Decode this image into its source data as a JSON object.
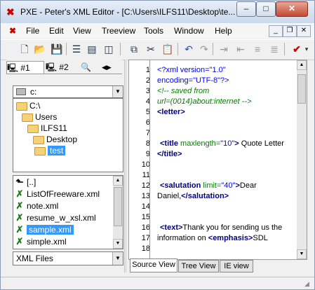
{
  "window": {
    "title": "PXE - Peter's XML Editor - [C:\\Users\\ILFS11\\Desktop\\te...",
    "minimize": "–",
    "maximize": "□",
    "close": "✕"
  },
  "menu": {
    "items": [
      "File",
      "Edit",
      "View",
      "Treeview",
      "Tools",
      "Window",
      "Help"
    ],
    "mdi_minimize": "_",
    "mdi_restore": "❐",
    "mdi_close": "✕"
  },
  "toolbar": {
    "icons": [
      "new-file-icon",
      "open-folder-icon",
      "save-icon",
      "tile-horizontal-icon",
      "tile-vertical-icon",
      "tile-icon",
      "copy-icon",
      "cut-icon",
      "paste-icon",
      "undo-icon",
      "redo-icon",
      "indent-icon",
      "outdent-icon",
      "format-icon",
      "validate-icon"
    ]
  },
  "left_tabs": {
    "tab1": "#1",
    "tab2": "#2"
  },
  "drive": {
    "value": "c:"
  },
  "directories": [
    {
      "label": "C:\\",
      "indent": 0
    },
    {
      "label": "Users",
      "indent": 1
    },
    {
      "label": "ILFS11",
      "indent": 2
    },
    {
      "label": "Desktop",
      "indent": 3
    },
    {
      "label": "test",
      "indent": 4,
      "selected": true
    }
  ],
  "parent_dir": "[..]",
  "files": [
    {
      "label": "ListOfFreeware.xml"
    },
    {
      "label": "note.xml"
    },
    {
      "label": "resume_w_xsl.xml"
    },
    {
      "label": "sample.xml",
      "selected": true
    },
    {
      "label": "simple.xml"
    }
  ],
  "file_filter": {
    "value": "XML Files"
  },
  "editor": {
    "line_numbers": [
      "1",
      "2",
      "3",
      "4",
      "5",
      "6",
      "7",
      "8",
      "9",
      "10",
      "11",
      "12",
      "13",
      "14",
      "15",
      "16",
      "17",
      "18"
    ],
    "lines": {
      "l1": "<?xml version=\"1.0\"",
      "l2": "encoding=\"UTF-8\"?>",
      "l3": "<!-- saved from",
      "l4": "url=(0014)about:internet -->",
      "l5": "<letter>",
      "l8a": "<title",
      "l8b": " maxlength=",
      "l8c": "\"10\"",
      "l8d": ">",
      "l8e": " Quote Letter",
      "l9": "</title>",
      "l12a": "<salutation",
      "l12b": " limit=",
      "l12c": "\"40\"",
      "l12d": ">",
      "l12e": "Dear",
      "l13a": "Daniel,",
      "l13b": "</salutation>",
      "l16a": "<text>",
      "l16b": "Thank you for sending us the",
      "l17a": "information on ",
      "l17b": "<emphasis>",
      "l17c": "SDL"
    }
  },
  "editor_tabs": [
    "Source View",
    "Tree View",
    "IE view"
  ],
  "colors": {
    "selection": "#3399ff",
    "tag": "#000080",
    "attribute": "#008000",
    "value": "#0000ff",
    "comment": "#008000"
  }
}
